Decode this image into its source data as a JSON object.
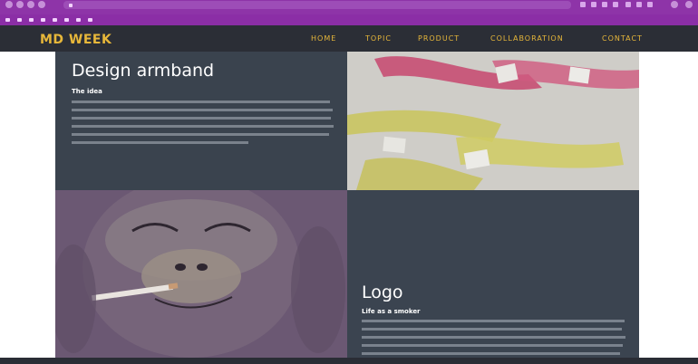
{
  "browser": {
    "url": "",
    "bookmarks": []
  },
  "header": {
    "logo": "MD WEEK",
    "nav": [
      "HOME",
      "TOPIC",
      "PRODUCT",
      "COLLABORATION",
      "CONTACT"
    ]
  },
  "sections": {
    "armband": {
      "title": "Design armband",
      "subtitle": "The idea",
      "body": ""
    },
    "logo": {
      "title": "Logo",
      "subtitle": "Life as a smoker",
      "body": ""
    }
  },
  "colors": {
    "browser_chrome": "#8e34a8",
    "header_bg": "#2b2e36",
    "accent": "#e7b73a",
    "panel_dark": "#3a434e",
    "panel_purple": "#6d5a75",
    "armband_pink": "#c7466f",
    "armband_yellow": "#c9c45a"
  },
  "icons": {
    "back": "arrow-left-icon",
    "forward": "arrow-right-icon",
    "reload": "reload-icon",
    "home": "home-icon",
    "secure": "lock-icon",
    "extensions": "puzzle-icon"
  }
}
